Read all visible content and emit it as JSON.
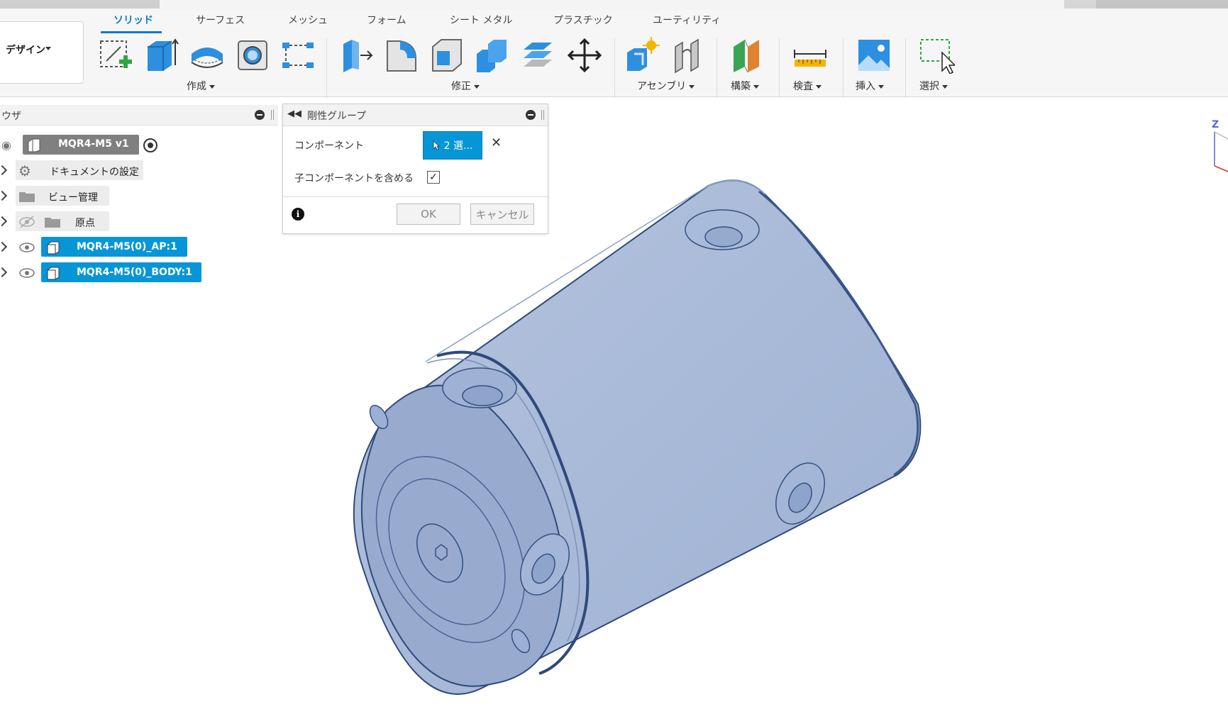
{
  "ribbon": {
    "workspace": "デザイン",
    "tabs": [
      {
        "label": "ソリッド",
        "active": true
      },
      {
        "label": "サーフェス"
      },
      {
        "label": "メッシュ"
      },
      {
        "label": "フォーム"
      },
      {
        "label": "シート メタル"
      },
      {
        "label": "プラスチック"
      },
      {
        "label": "ユーティリティ"
      }
    ],
    "groups": {
      "create": "作成",
      "modify": "修正",
      "assemble": "アセンブリ",
      "construct": "構築",
      "inspect": "検査",
      "insert": "挿入",
      "select": "選択"
    }
  },
  "browser": {
    "title": "ウザ",
    "root": "MQR4-M5 v1",
    "items": [
      {
        "label": "ドキュメントの設定",
        "icon": "gear-icon"
      },
      {
        "label": "ビュー管理",
        "icon": "folder-icon"
      },
      {
        "label": "原点",
        "icon": "folder-icon",
        "hidden": true
      },
      {
        "label": "MQR4-M5(0)_AP:1",
        "icon": "component-icon",
        "selected": true
      },
      {
        "label": "MQR4-M5(0)_BODY:1",
        "icon": "component-icon",
        "selected": true
      }
    ]
  },
  "dialog": {
    "title": "剛性グループ",
    "component_label": "コンポーネント",
    "selection_value": "2 選...",
    "include_children_label": "子コンポーネントを含める",
    "include_children_checked": true,
    "ok_label": "OK",
    "cancel_label": "キャンセル",
    "info_glyph": "i"
  },
  "viewcube": {
    "axis_label": "Z"
  },
  "colors": {
    "accent": "#0a79d1",
    "selection": "#0696d7",
    "model_fill": "#a7b8d6",
    "model_edge": "#2f4a7a"
  }
}
